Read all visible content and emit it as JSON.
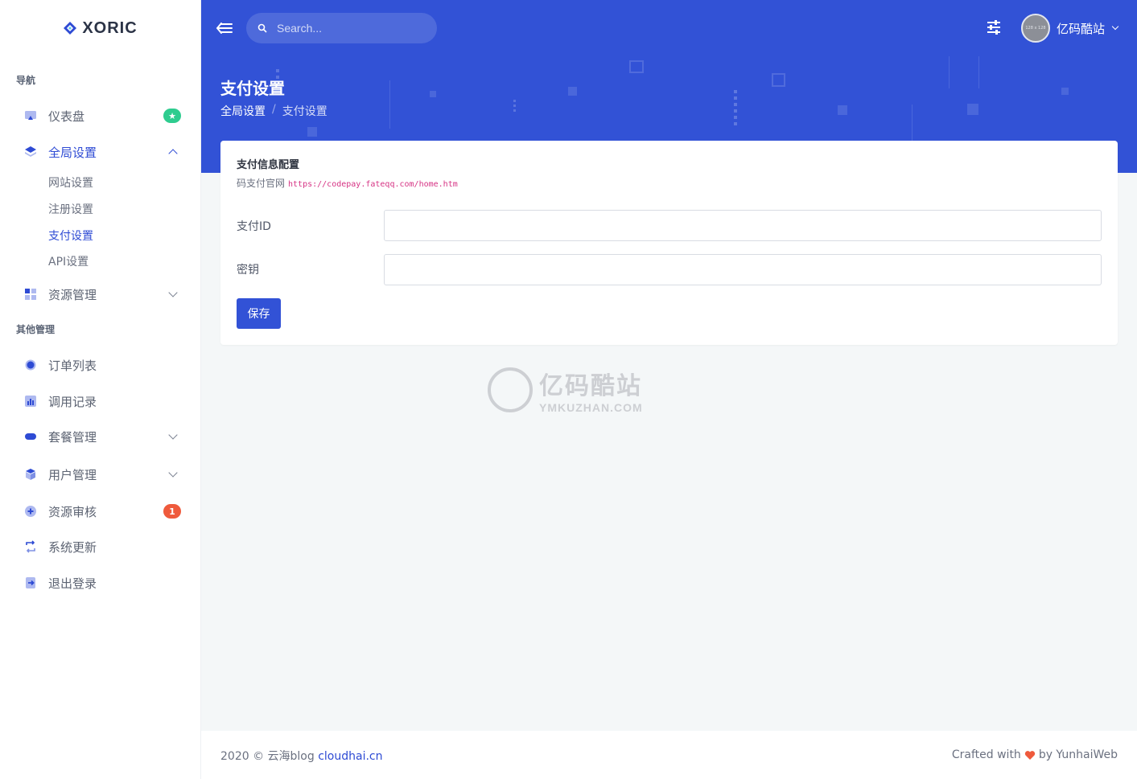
{
  "brand": {
    "name": "XORIC"
  },
  "sidebar": {
    "heading_nav": "导航",
    "heading_other": "其他管理",
    "items": [
      {
        "label": "仪表盘",
        "icon": "monitor-icon",
        "badge": "★"
      },
      {
        "label": "全局设置",
        "icon": "layers-icon"
      },
      {
        "label": "资源管理",
        "icon": "grid-icon"
      },
      {
        "label": "订单列表",
        "icon": "circle-icon"
      },
      {
        "label": "调用记录",
        "icon": "bar-chart-icon"
      },
      {
        "label": "套餐管理",
        "icon": "pill-icon"
      },
      {
        "label": "用户管理",
        "icon": "cube-icon"
      },
      {
        "label": "资源审核",
        "icon": "chat-icon",
        "badge": "1"
      },
      {
        "label": "系统更新",
        "icon": "refresh-icon"
      },
      {
        "label": "退出登录",
        "icon": "logout-icon"
      }
    ],
    "subitems": [
      {
        "label": "网站设置"
      },
      {
        "label": "注册设置"
      },
      {
        "label": "支付设置"
      },
      {
        "label": "API设置"
      }
    ]
  },
  "topbar": {
    "search_placeholder": "Search...",
    "user_name": "亿码酷站",
    "avatar_text": "128 x 128"
  },
  "header": {
    "title": "支付设置",
    "breadcrumb": [
      "全局设置",
      "/",
      "支付设置"
    ]
  },
  "card": {
    "title": "支付信息配置",
    "subtitle": "码支付官网",
    "link": "https://codepay.fateqq.com/home.htm",
    "fields": [
      {
        "label": "支付ID",
        "value": ""
      },
      {
        "label": "密钥",
        "value": ""
      }
    ],
    "save_label": "保存"
  },
  "watermark": {
    "main": "亿码酷站",
    "sub": "YMKUZHAN.COM"
  },
  "footer": {
    "copyright": "2020 © 云海blog ",
    "link": "cloudhai.cn",
    "crafted": "Crafted with",
    "by": "by YunhaiWeb"
  },
  "colors": {
    "primary": "#3252d6",
    "success": "#2ecc8f",
    "danger": "#ef5a3c"
  }
}
